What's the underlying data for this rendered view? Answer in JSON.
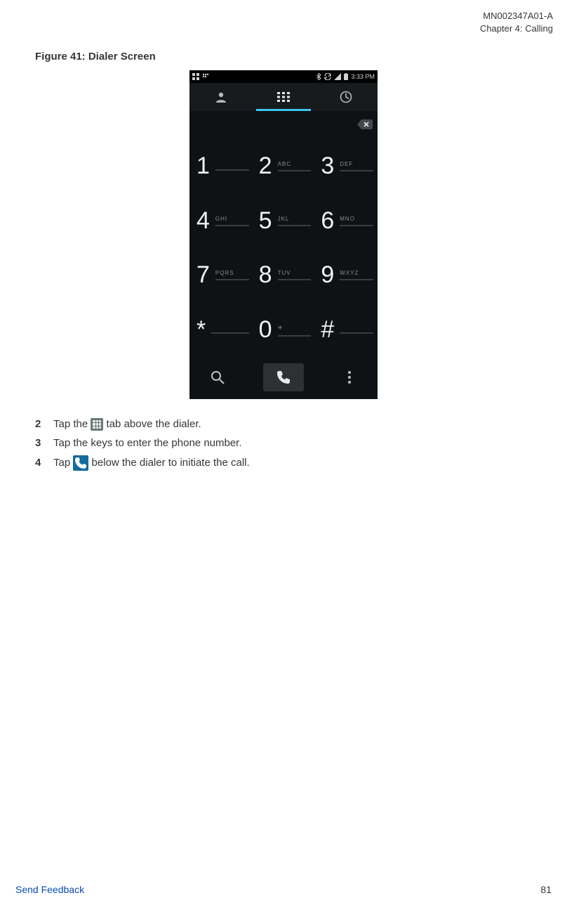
{
  "header": {
    "doc_id": "MN002347A01-A",
    "chapter": "Chapter 4:  Calling"
  },
  "figure_caption": "Figure 41: Dialer Screen",
  "phone": {
    "status_time": "3:33 PM",
    "keys": [
      {
        "digit": "1",
        "aux": ""
      },
      {
        "digit": "2",
        "aux": "ABC"
      },
      {
        "digit": "3",
        "aux": "DEF"
      },
      {
        "digit": "4",
        "aux": "GHI"
      },
      {
        "digit": "5",
        "aux": "JKL"
      },
      {
        "digit": "6",
        "aux": "MNO"
      },
      {
        "digit": "7",
        "aux": "PQRS"
      },
      {
        "digit": "8",
        "aux": "TUV"
      },
      {
        "digit": "9",
        "aux": "WXYZ"
      },
      {
        "digit": "*",
        "aux": ""
      },
      {
        "digit": "0",
        "aux": "+"
      },
      {
        "digit": "#",
        "aux": ""
      }
    ]
  },
  "steps": {
    "s2": {
      "num": "2",
      "pre": "Tap the ",
      "post": " tab above the dialer."
    },
    "s3": {
      "num": "3",
      "text": "Tap the keys to enter the phone number."
    },
    "s4": {
      "num": "4",
      "pre": "Tap ",
      "post": " below the dialer to initiate the call."
    }
  },
  "footer": {
    "feedback": "Send Feedback",
    "page": "81"
  }
}
